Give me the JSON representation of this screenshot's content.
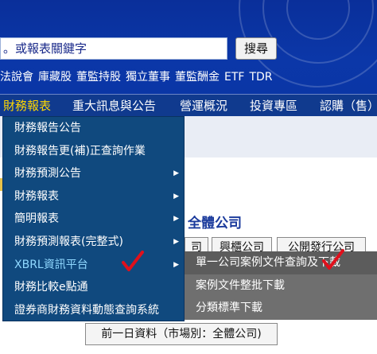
{
  "header": {
    "search": {
      "value": "。或報表關鍵字",
      "button_label": "搜尋"
    },
    "quick_links": [
      "法說會",
      "庫藏股",
      "董監持股",
      "獨立董事",
      "董監酬金",
      "ETF",
      "TDR"
    ]
  },
  "nav": {
    "items": [
      "財務報表",
      "重大訊息與公告",
      "營運概況",
      "投資專區",
      "認購（售）"
    ]
  },
  "dropdown": {
    "items": [
      {
        "label": "財務報告公告",
        "has_submenu": false
      },
      {
        "label": "財務報告更(補)正查詢作業",
        "has_submenu": false
      },
      {
        "label": "財務預測公告",
        "has_submenu": true
      },
      {
        "label": "財務報表",
        "has_submenu": true
      },
      {
        "label": "簡明報表",
        "has_submenu": true
      },
      {
        "label": "財務預測報表(完整式)",
        "has_submenu": true
      },
      {
        "label": "XBRL資訊平台",
        "has_submenu": true
      },
      {
        "label": "財務比較e點通",
        "has_submenu": false
      },
      {
        "label": "證券商財務資料動態查詢系統",
        "has_submenu": false
      }
    ],
    "arrow_glyph": "▶"
  },
  "submenu": {
    "items": [
      "單一公司案例文件查詢及下載",
      "案例文件整批下載",
      "分類標準下載"
    ]
  },
  "page": {
    "heading": "全體公司",
    "tabs": [
      "司",
      "興櫃公司",
      "公開發行公司"
    ],
    "prev_day_button": "前一日資料（市場別：全體公司)"
  },
  "colors": {
    "header_bg": "#0b37a8",
    "nav_bg": "#103a8e",
    "nav_active": "#ffd700",
    "menu_bg": "#10497e",
    "submenu_bg": "#6f6f6f",
    "check_red": "#e0101c"
  }
}
